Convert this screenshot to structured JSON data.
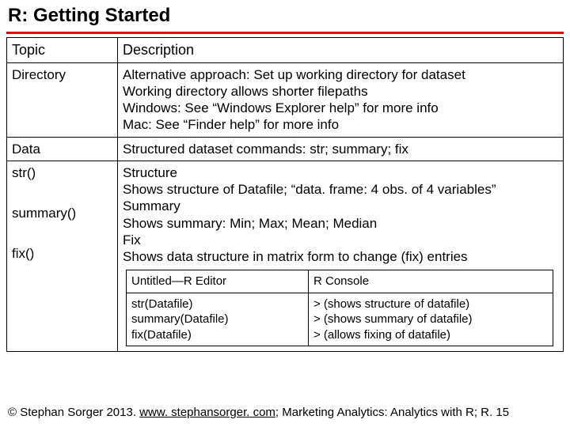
{
  "title": "R: Getting Started",
  "headers": {
    "topic": "Topic",
    "description": "Description"
  },
  "rows": {
    "directory": {
      "topic": "Directory",
      "lines": [
        "Alternative approach: Set up working directory for dataset",
        "Working directory allows shorter filepaths",
        "Windows: See “Windows Explorer help” for more info",
        "Mac: See “Finder help” for more info"
      ]
    },
    "data": {
      "topic": "Data",
      "desc": "Structured dataset commands: str; summary; fix"
    },
    "funcs": {
      "topics": [
        "str()",
        "summary()",
        "fix()"
      ],
      "lines": [
        "Structure",
        "Shows structure of Datafile; “data. frame: 4 obs. of 4 variables”",
        "Summary",
        "Shows summary: Min; Max; Mean; Median",
        "Fix",
        "Shows data structure in matrix form to change (fix) entries"
      ]
    }
  },
  "inner": {
    "headers": {
      "left": "Untitled—R Editor",
      "right": "R Console"
    },
    "left": [
      "str(Datafile)",
      "summary(Datafile)",
      "fix(Datafile)"
    ],
    "right": [
      "> (shows structure of datafile)",
      "> (shows summary of datafile)",
      "> (allows fixing of datafile)"
    ]
  },
  "footer": {
    "prefix": "© Stephan Sorger 2013. ",
    "link_text": "www. stephansorger. com",
    "link_href": "http://www.stephansorger.com",
    "suffix": "; Marketing Analytics: Analytics with R;  R. 15"
  }
}
